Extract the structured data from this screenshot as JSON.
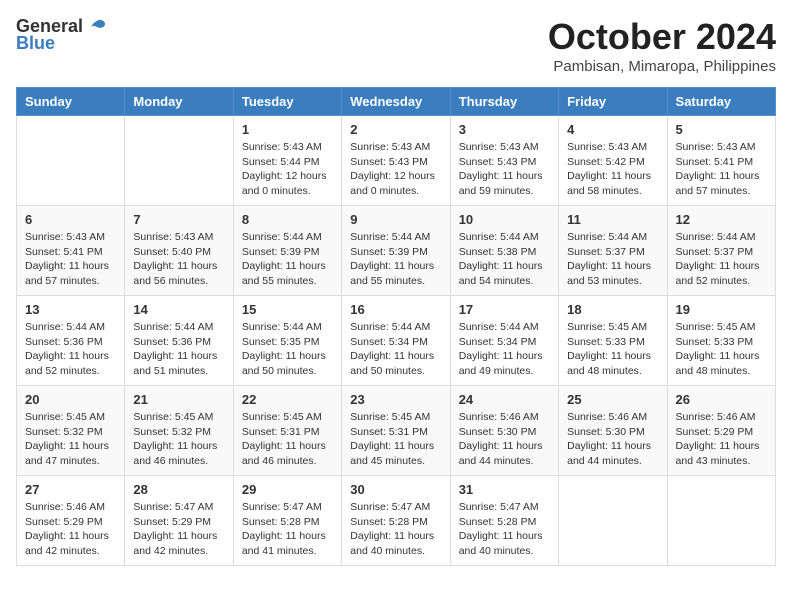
{
  "header": {
    "logo_general": "General",
    "logo_blue": "Blue",
    "month_title": "October 2024",
    "location": "Pambisan, Mimaropa, Philippines"
  },
  "calendar": {
    "days_of_week": [
      "Sunday",
      "Monday",
      "Tuesday",
      "Wednesday",
      "Thursday",
      "Friday",
      "Saturday"
    ],
    "weeks": [
      [
        {
          "day": "",
          "info": ""
        },
        {
          "day": "",
          "info": ""
        },
        {
          "day": "1",
          "info": "Sunrise: 5:43 AM\nSunset: 5:44 PM\nDaylight: 12 hours\nand 0 minutes."
        },
        {
          "day": "2",
          "info": "Sunrise: 5:43 AM\nSunset: 5:43 PM\nDaylight: 12 hours\nand 0 minutes."
        },
        {
          "day": "3",
          "info": "Sunrise: 5:43 AM\nSunset: 5:43 PM\nDaylight: 11 hours\nand 59 minutes."
        },
        {
          "day": "4",
          "info": "Sunrise: 5:43 AM\nSunset: 5:42 PM\nDaylight: 11 hours\nand 58 minutes."
        },
        {
          "day": "5",
          "info": "Sunrise: 5:43 AM\nSunset: 5:41 PM\nDaylight: 11 hours\nand 57 minutes."
        }
      ],
      [
        {
          "day": "6",
          "info": "Sunrise: 5:43 AM\nSunset: 5:41 PM\nDaylight: 11 hours\nand 57 minutes."
        },
        {
          "day": "7",
          "info": "Sunrise: 5:43 AM\nSunset: 5:40 PM\nDaylight: 11 hours\nand 56 minutes."
        },
        {
          "day": "8",
          "info": "Sunrise: 5:44 AM\nSunset: 5:39 PM\nDaylight: 11 hours\nand 55 minutes."
        },
        {
          "day": "9",
          "info": "Sunrise: 5:44 AM\nSunset: 5:39 PM\nDaylight: 11 hours\nand 55 minutes."
        },
        {
          "day": "10",
          "info": "Sunrise: 5:44 AM\nSunset: 5:38 PM\nDaylight: 11 hours\nand 54 minutes."
        },
        {
          "day": "11",
          "info": "Sunrise: 5:44 AM\nSunset: 5:37 PM\nDaylight: 11 hours\nand 53 minutes."
        },
        {
          "day": "12",
          "info": "Sunrise: 5:44 AM\nSunset: 5:37 PM\nDaylight: 11 hours\nand 52 minutes."
        }
      ],
      [
        {
          "day": "13",
          "info": "Sunrise: 5:44 AM\nSunset: 5:36 PM\nDaylight: 11 hours\nand 52 minutes."
        },
        {
          "day": "14",
          "info": "Sunrise: 5:44 AM\nSunset: 5:36 PM\nDaylight: 11 hours\nand 51 minutes."
        },
        {
          "day": "15",
          "info": "Sunrise: 5:44 AM\nSunset: 5:35 PM\nDaylight: 11 hours\nand 50 minutes."
        },
        {
          "day": "16",
          "info": "Sunrise: 5:44 AM\nSunset: 5:34 PM\nDaylight: 11 hours\nand 50 minutes."
        },
        {
          "day": "17",
          "info": "Sunrise: 5:44 AM\nSunset: 5:34 PM\nDaylight: 11 hours\nand 49 minutes."
        },
        {
          "day": "18",
          "info": "Sunrise: 5:45 AM\nSunset: 5:33 PM\nDaylight: 11 hours\nand 48 minutes."
        },
        {
          "day": "19",
          "info": "Sunrise: 5:45 AM\nSunset: 5:33 PM\nDaylight: 11 hours\nand 48 minutes."
        }
      ],
      [
        {
          "day": "20",
          "info": "Sunrise: 5:45 AM\nSunset: 5:32 PM\nDaylight: 11 hours\nand 47 minutes."
        },
        {
          "day": "21",
          "info": "Sunrise: 5:45 AM\nSunset: 5:32 PM\nDaylight: 11 hours\nand 46 minutes."
        },
        {
          "day": "22",
          "info": "Sunrise: 5:45 AM\nSunset: 5:31 PM\nDaylight: 11 hours\nand 46 minutes."
        },
        {
          "day": "23",
          "info": "Sunrise: 5:45 AM\nSunset: 5:31 PM\nDaylight: 11 hours\nand 45 minutes."
        },
        {
          "day": "24",
          "info": "Sunrise: 5:46 AM\nSunset: 5:30 PM\nDaylight: 11 hours\nand 44 minutes."
        },
        {
          "day": "25",
          "info": "Sunrise: 5:46 AM\nSunset: 5:30 PM\nDaylight: 11 hours\nand 44 minutes."
        },
        {
          "day": "26",
          "info": "Sunrise: 5:46 AM\nSunset: 5:29 PM\nDaylight: 11 hours\nand 43 minutes."
        }
      ],
      [
        {
          "day": "27",
          "info": "Sunrise: 5:46 AM\nSunset: 5:29 PM\nDaylight: 11 hours\nand 42 minutes."
        },
        {
          "day": "28",
          "info": "Sunrise: 5:47 AM\nSunset: 5:29 PM\nDaylight: 11 hours\nand 42 minutes."
        },
        {
          "day": "29",
          "info": "Sunrise: 5:47 AM\nSunset: 5:28 PM\nDaylight: 11 hours\nand 41 minutes."
        },
        {
          "day": "30",
          "info": "Sunrise: 5:47 AM\nSunset: 5:28 PM\nDaylight: 11 hours\nand 40 minutes."
        },
        {
          "day": "31",
          "info": "Sunrise: 5:47 AM\nSunset: 5:28 PM\nDaylight: 11 hours\nand 40 minutes."
        },
        {
          "day": "",
          "info": ""
        },
        {
          "day": "",
          "info": ""
        }
      ]
    ]
  }
}
